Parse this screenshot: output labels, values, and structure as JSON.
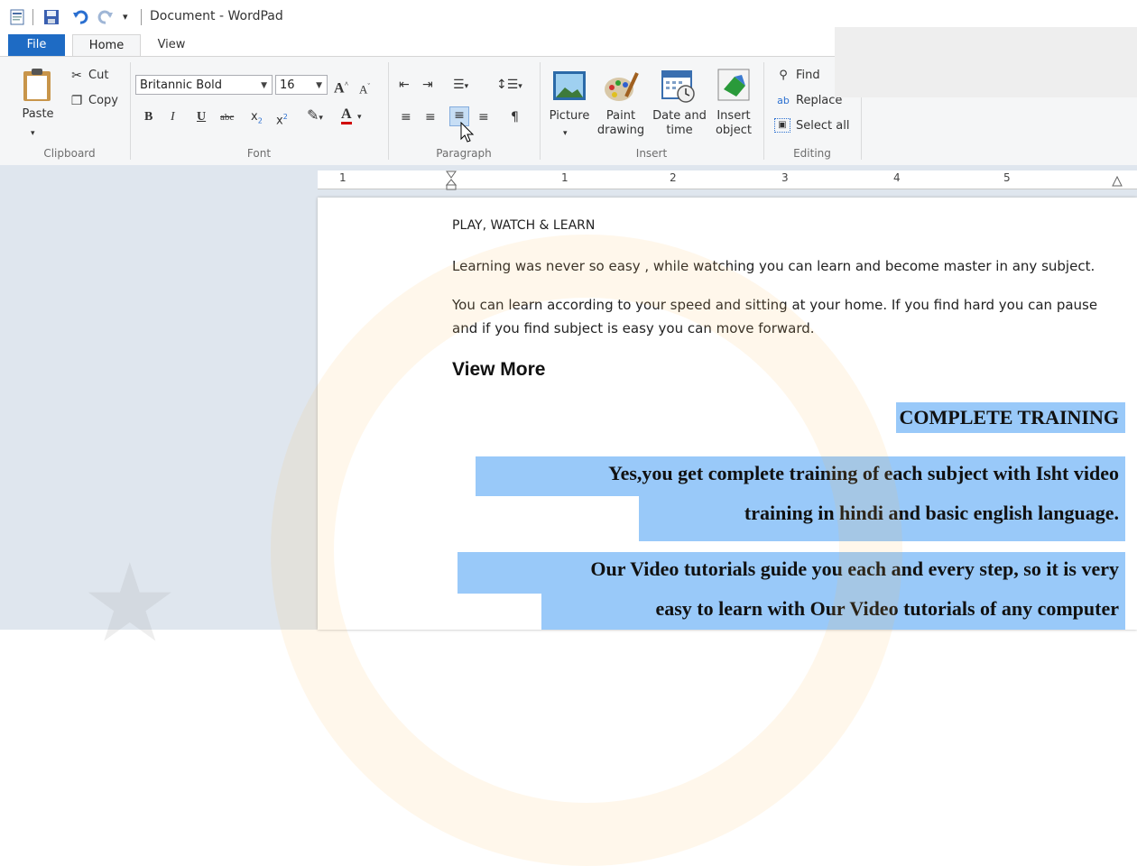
{
  "window": {
    "title": "Document - WordPad"
  },
  "tabs": {
    "file": "File",
    "home": "Home",
    "view": "View"
  },
  "clipboard": {
    "paste": "Paste",
    "cut": "Cut",
    "copy": "Copy",
    "group": "Clipboard"
  },
  "font": {
    "family": "Britannic Bold",
    "size": "16",
    "group": "Font"
  },
  "paragraph": {
    "group": "Paragraph"
  },
  "insert": {
    "picture": "Picture",
    "paint_1": "Paint",
    "paint_2": "drawing",
    "date_1": "Date and",
    "date_2": "time",
    "object_1": "Insert",
    "object_2": "object",
    "group": "Insert"
  },
  "editing": {
    "find": "Find",
    "replace": "Replace",
    "select_all": "Select all",
    "group": "Editing"
  },
  "ruler": {
    "marks": [
      "1",
      "1",
      "2",
      "3",
      "4",
      "5"
    ]
  },
  "document": {
    "line1": "PLAY, WATCH & LEARN",
    "line2": "Learning was never so easy , while watching you can learn and become master in any subject.",
    "line3a": "You can learn according to your speed and sitting at your home. If you find hard you can pause",
    "line3b": "and if you find subject is easy you can move forward.",
    "heading": "View More",
    "sel1": "COMPLETE TRAINING",
    "sel2a": "Yes,you get complete training of each subject with Isht video",
    "sel2b": "training in hindi and basic english language.",
    "sel3a": "Our Video tutorials guide you each and every step, so it is very",
    "sel3b": "easy to learn with Our Video tutorials of any computer"
  },
  "colors": {
    "file_tab": "#1e6bc4",
    "selection": "#99c9f9",
    "doc_bg": "#dfe6ee"
  }
}
